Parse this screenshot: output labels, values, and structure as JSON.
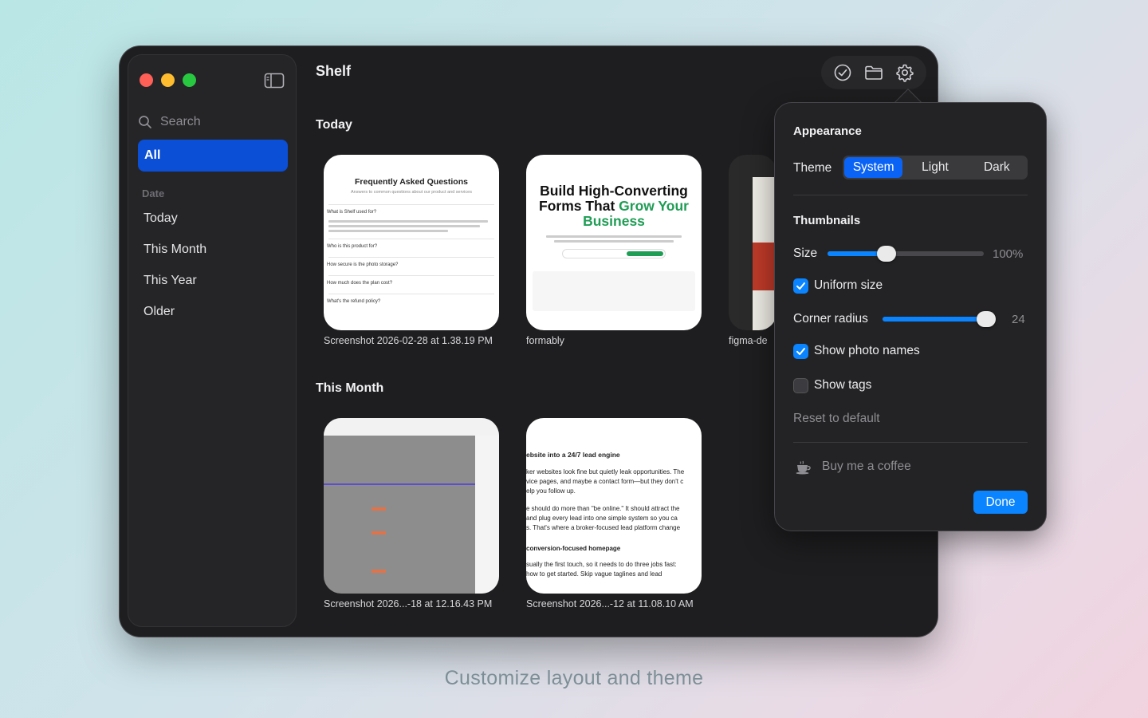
{
  "app": {
    "title": "Shelf"
  },
  "sidebar": {
    "search_placeholder": "Search",
    "all_label": "All",
    "section_label": "Date",
    "items": [
      {
        "label": "Today"
      },
      {
        "label": "This Month"
      },
      {
        "label": "This Year"
      },
      {
        "label": "Older"
      }
    ]
  },
  "toolbar": {
    "icons": [
      "checkmark-circle-icon",
      "folder-icon",
      "gear-icon"
    ]
  },
  "groups": [
    {
      "title": "Today",
      "items": [
        {
          "name": "Screenshot 2026-02-28 at 1.38.19 PM",
          "preview_title": "Frequently Asked Questions"
        },
        {
          "name": "formably",
          "preview_title": "Build High-Converting Forms That Grow Your Business"
        },
        {
          "name": "figma-de"
        }
      ]
    },
    {
      "title": "This Month",
      "items": [
        {
          "name": "Screenshot 2026...-18 at 12.16.43 PM"
        },
        {
          "name": "Screenshot 2026...-12 at 11.08.10 AM",
          "preview_title": "ebsite into a 24/7 lead engine"
        }
      ]
    }
  ],
  "preview_texts": {
    "faq_sub": "Answers to common questions about our product and services",
    "faq_q1": "What is Shelf used for?",
    "faq_q2": "Who is this product for?",
    "faq_q3": "How secure is the photo storage?",
    "faq_q4": "How much does the plan cost?",
    "faq_q5": "What's the refund policy?",
    "formably_h1": "Build High-Converting",
    "formably_h2a": "Forms That ",
    "formably_h2b": "Grow Your",
    "formably_h3": "Business",
    "lead_p1": "ker websites look fine but quietly leak opportunities. The",
    "lead_p2": "vice pages, and maybe a contact form—but they don't c",
    "lead_p3": "elp you follow up.",
    "lead_p4": "e should do more than \"be online.\" It should attract the",
    "lead_p5": "and plug every lead into one simple system so you ca",
    "lead_p6": "s. That's where a broker-focused lead platform change",
    "lead_h2": "conversion-focused homepage",
    "lead_p7": "sually the first touch, so it needs to do three jobs fast:",
    "lead_p8": "how to get started. Skip vague taglines and lead"
  },
  "popover": {
    "appearance_heading": "Appearance",
    "theme_label": "Theme",
    "theme_options": [
      "System",
      "Light",
      "Dark"
    ],
    "theme_selected": "System",
    "thumbnails_heading": "Thumbnails",
    "size_label": "Size",
    "size_value": "100%",
    "size_fraction": 0.36,
    "uniform_size_label": "Uniform size",
    "uniform_size_checked": true,
    "corner_radius_label": "Corner radius",
    "corner_radius_value": "24",
    "corner_radius_fraction": 1.0,
    "show_photo_names_label": "Show photo names",
    "show_photo_names_checked": true,
    "show_tags_label": "Show tags",
    "show_tags_checked": false,
    "reset_label": "Reset to default",
    "coffee_label": "Buy me a coffee",
    "done_label": "Done"
  },
  "caption": "Customize layout and theme",
  "colors": {
    "accent": "#0a84ff",
    "selected_nav": "#0a4fd6",
    "window_bg": "#1e1e20",
    "green_text": "#1f9d55"
  }
}
